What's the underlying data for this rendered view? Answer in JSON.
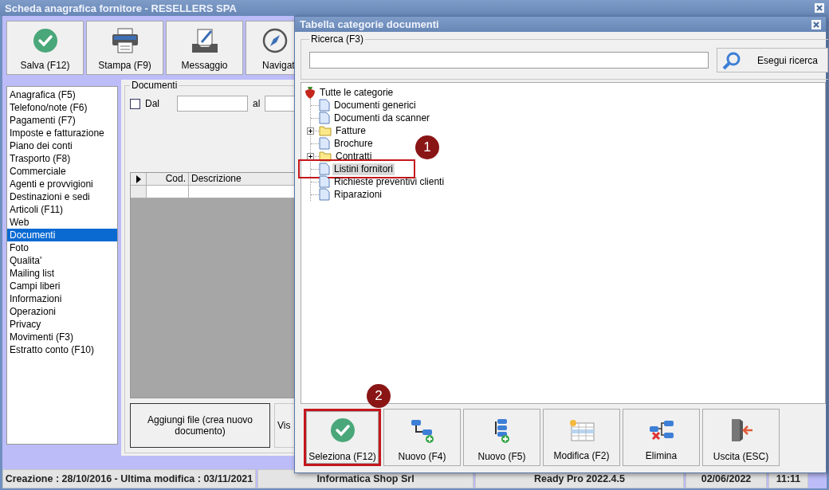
{
  "main_window": {
    "title": "Scheda anagrafica fornitore - RESELLERS SPA"
  },
  "toolbar": [
    {
      "label": "Salva (F12)",
      "kind": "save"
    },
    {
      "label": "Stampa (F9)",
      "kind": "print"
    },
    {
      "label": "Messaggio",
      "kind": "message"
    },
    {
      "label": "Navigat",
      "kind": "navigate"
    }
  ],
  "sections": [
    {
      "label": "Anagrafica (F5)",
      "selected": false
    },
    {
      "label": "Telefono/note (F6)",
      "selected": false
    },
    {
      "label": "Pagamenti (F7)",
      "selected": false
    },
    {
      "label": "Imposte e fatturazione",
      "selected": false
    },
    {
      "label": "Piano dei conti",
      "selected": false
    },
    {
      "label": "Trasporto (F8)",
      "selected": false
    },
    {
      "label": "Commerciale",
      "selected": false
    },
    {
      "label": "Agenti e provvigioni",
      "selected": false
    },
    {
      "label": "Destinazioni e sedi",
      "selected": false
    },
    {
      "label": "Articoli (F11)",
      "selected": false
    },
    {
      "label": "Web",
      "selected": false
    },
    {
      "label": "Documenti",
      "selected": true
    },
    {
      "label": "Foto",
      "selected": false
    },
    {
      "label": "Qualita'",
      "selected": false
    },
    {
      "label": "Mailing list",
      "selected": false
    },
    {
      "label": "Campi liberi",
      "selected": false
    },
    {
      "label": "Informazioni",
      "selected": false
    },
    {
      "label": "Operazioni",
      "selected": false
    },
    {
      "label": "Privacy",
      "selected": false
    },
    {
      "label": "Movimenti (F3)",
      "selected": false
    },
    {
      "label": "Estratto conto (F10)",
      "selected": false
    }
  ],
  "documents": {
    "title": "Documenti",
    "from_label": "Dal",
    "from_checked": false,
    "to_label": "al",
    "table": {
      "columns": [
        "Cod.",
        "Descrizione"
      ]
    },
    "buttons": [
      "Aggiungi file (crea nuovo documento)",
      "Vis"
    ]
  },
  "status_bar": [
    "Creazione : 28/10/2016 - Ultima modifica : 03/11/2021",
    "Informatica Shop Srl",
    "Ready Pro 2022.4.5",
    "02/06/2022",
    "11:11"
  ],
  "dialog": {
    "title": "Tabella categorie documenti",
    "search": {
      "label": "Ricerca (F3)",
      "button": "Esegui ricerca"
    },
    "tree": {
      "label": "Tutte le categorie",
      "children": [
        {
          "label": "Documenti generici",
          "kind": "document",
          "selected": false
        },
        {
          "label": "Documenti da scanner",
          "kind": "document",
          "selected": false
        },
        {
          "label": "Fatture",
          "kind": "folder",
          "selected": false,
          "expanded": false
        },
        {
          "label": "Brochure",
          "kind": "document",
          "selected": false
        },
        {
          "label": "Contratti",
          "kind": "folder",
          "selected": false,
          "expanded": false
        },
        {
          "label": "Listini fornitori",
          "kind": "document",
          "selected": true,
          "callout": "1"
        },
        {
          "label": "Richieste preventivi clienti",
          "kind": "document",
          "selected": false
        },
        {
          "label": "Riparazioni",
          "kind": "document",
          "selected": false
        }
      ]
    },
    "buttons": [
      {
        "label": "Seleziona (F12)",
        "kind": "select",
        "callout": "2"
      },
      {
        "label": "Nuovo (F4)",
        "kind": "new-sibling"
      },
      {
        "label": "Nuovo (F5)",
        "kind": "new-child"
      },
      {
        "label": "Modifica (F2)",
        "kind": "edit"
      },
      {
        "label": "Elimina",
        "kind": "delete"
      },
      {
        "label": "Uscita (ESC)",
        "kind": "exit"
      }
    ]
  }
}
